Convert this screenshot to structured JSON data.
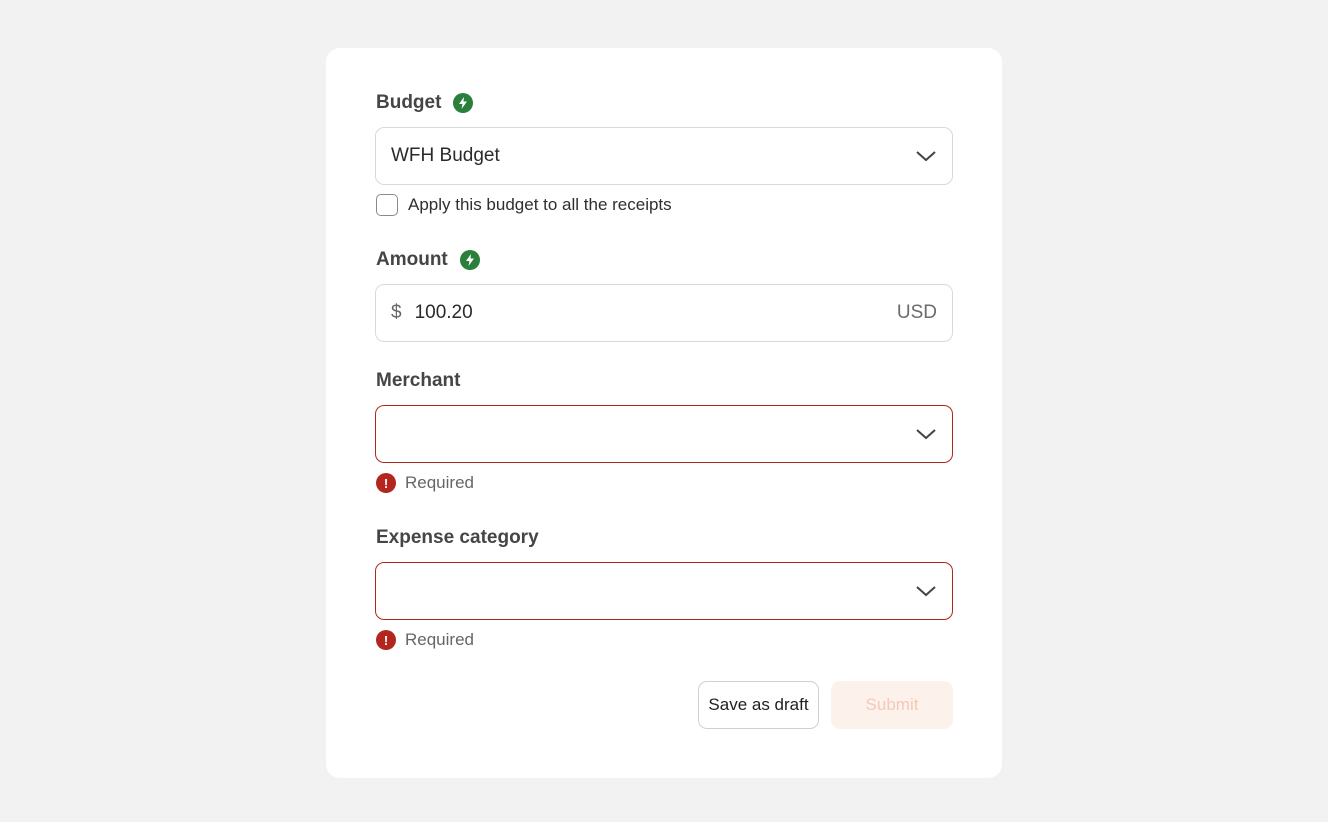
{
  "form": {
    "budget": {
      "label": "Budget",
      "value": "WFH Budget",
      "apply_all_label": "Apply this budget to all the receipts",
      "apply_all_checked": false
    },
    "amount": {
      "label": "Amount",
      "currency_symbol": "$",
      "value": "100.20",
      "currency_code": "USD"
    },
    "merchant": {
      "label": "Merchant",
      "value": "",
      "error": "Required"
    },
    "expense_category": {
      "label": "Expense category",
      "value": "",
      "error": "Required"
    },
    "actions": {
      "save_draft_label": "Save as draft",
      "submit_label": "Submit"
    }
  },
  "colors": {
    "accent_green": "#2a7f3a",
    "error_red": "#b3261e",
    "submit_disabled_bg": "#fdf1ec"
  },
  "icons": {
    "budget_badge": "lightning-icon",
    "amount_badge": "lightning-icon",
    "dropdown": "chevron-down-icon",
    "error": "exclamation-icon"
  }
}
